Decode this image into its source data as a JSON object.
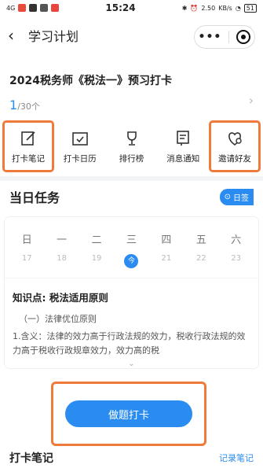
{
  "status_bar": {
    "network": "4G",
    "time": "15:24",
    "speed": "2.50",
    "speed_unit": "KB/s",
    "battery": "51"
  },
  "nav": {
    "title": "学习计划",
    "more": "•••"
  },
  "plan": {
    "title": "2024税务师《税法一》预习打卡",
    "progress_current": "1",
    "progress_total": "/30个"
  },
  "tools": [
    {
      "label": "打卡笔记",
      "icon": "edit-note-icon"
    },
    {
      "label": "打卡日历",
      "icon": "calendar-check-icon"
    },
    {
      "label": "排行榜",
      "icon": "trophy-icon"
    },
    {
      "label": "消息通知",
      "icon": "message-icon"
    },
    {
      "label": "邀请好友",
      "icon": "invite-heart-icon"
    }
  ],
  "daily": {
    "title": "当日任务",
    "sign_label": "日签",
    "weekdays": [
      "日",
      "一",
      "二",
      "三",
      "四",
      "五",
      "六"
    ],
    "dates": [
      "17",
      "18",
      "19",
      "今",
      "21",
      "22",
      "23"
    ],
    "knowledge_title": "知识点: 税法适用原则",
    "knowledge_sub": "（一）法律优位原则",
    "knowledge_body": "1.含义：法律的效力高于行政法规的效力，税收行政法规的效力高于税收行政规章效力，效力高的税",
    "expand": "⌄"
  },
  "action": {
    "do_label": "做题打卡"
  },
  "notes": {
    "title": "打卡笔记",
    "link": "记录笔记"
  },
  "colors": {
    "accent": "#2a8cf0",
    "highlight": "#ee7a3c"
  }
}
